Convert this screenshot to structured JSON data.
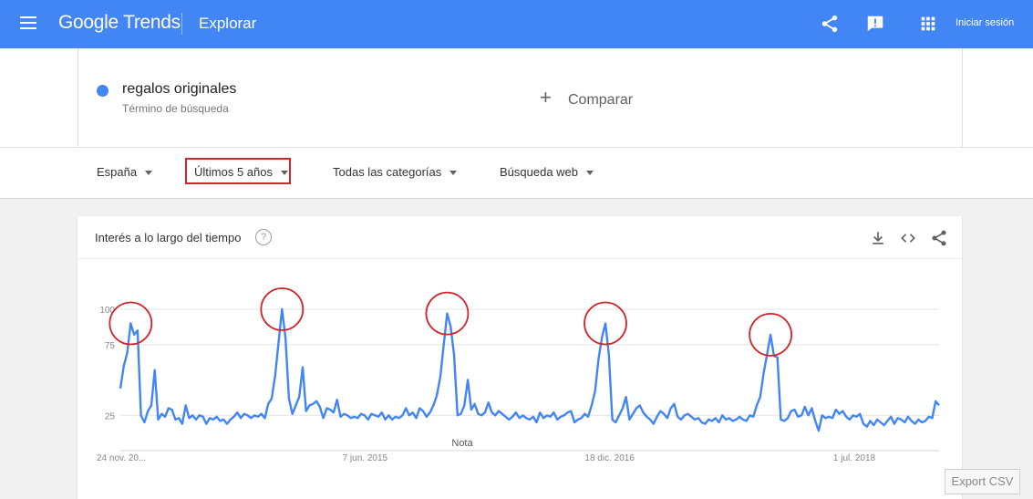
{
  "header": {
    "brand": "Google Trends",
    "section": "Explorar",
    "signin": "Iniciar sesión",
    "icons": [
      "menu-icon",
      "share-icon",
      "feedback-icon",
      "apps-icon"
    ]
  },
  "search": {
    "term": "regalos originales",
    "term_type": "Término de búsqueda",
    "compare_label": "Comparar",
    "term_color": "#4285f4"
  },
  "filters": {
    "region": "España",
    "period": "Últimos 5 años",
    "category": "Todas las categorías",
    "search_type": "Búsqueda web"
  },
  "card": {
    "title": "Interés a lo largo del tiempo",
    "help": "?",
    "note": "Nota",
    "export": "Export CSV",
    "icons": [
      "download-icon",
      "embed-icon",
      "share-icon"
    ]
  },
  "colors": {
    "header": "#4285f4",
    "line": "#4285f4",
    "highlight": "#d0262b"
  },
  "chart_data": {
    "type": "line",
    "x_start": "24 nov. 2013",
    "x_end": "18 nov. 2018",
    "x_ticks": [
      {
        "date": "2013-11-24",
        "label": "24 nov. 20..."
      },
      {
        "date": "2015-06-07",
        "label": "7 jun. 2015"
      },
      {
        "date": "2016-12-18",
        "label": "18 dic. 2016"
      },
      {
        "date": "2018-07-01",
        "label": "1 jul. 2018"
      }
    ],
    "y_ticks": [
      {
        "value": 100,
        "label": "100"
      },
      {
        "value": 75,
        "label": "75"
      },
      {
        "value": 25,
        "label": "25"
      }
    ],
    "ylim": [
      0,
      100
    ],
    "grid": true,
    "series": [
      {
        "name": "regalos originales",
        "values": [
          44,
          60,
          69,
          90,
          82,
          85,
          25,
          20,
          28,
          32,
          57,
          22,
          26,
          24,
          30,
          29,
          22,
          23,
          19,
          32,
          23,
          25,
          22,
          25,
          24,
          19,
          23,
          22,
          24,
          21,
          22,
          19,
          22,
          24,
          27,
          23,
          26,
          25,
          23,
          25,
          24,
          26,
          23,
          33,
          37,
          53,
          77,
          100,
          80,
          37,
          26,
          32,
          38,
          59,
          28,
          32,
          33,
          35,
          31,
          23,
          30,
          29,
          27,
          36,
          24,
          26,
          25,
          23,
          24,
          23,
          26,
          25,
          22,
          26,
          25,
          24,
          27,
          22,
          25,
          22,
          24,
          23,
          25,
          30,
          25,
          27,
          23,
          30,
          28,
          24,
          27,
          32,
          39,
          52,
          75,
          97,
          88,
          68,
          25,
          26,
          32,
          50,
          29,
          33,
          26,
          25,
          27,
          34,
          27,
          25,
          28,
          26,
          24,
          22,
          24,
          27,
          23,
          25,
          23,
          22,
          24,
          20,
          27,
          23,
          25,
          24,
          27,
          22,
          24,
          25,
          27,
          28,
          20,
          22,
          23,
          26,
          24,
          32,
          42,
          65,
          80,
          90,
          68,
          22,
          20,
          25,
          30,
          38,
          22,
          26,
          30,
          32,
          27,
          24,
          22,
          19,
          24,
          28,
          26,
          23,
          30,
          33,
          24,
          22,
          25,
          26,
          24,
          22,
          23,
          20,
          19,
          22,
          21,
          23,
          20,
          25,
          22,
          23,
          21,
          22,
          24,
          22,
          21,
          25,
          24,
          32,
          38,
          55,
          68,
          82,
          67,
          66,
          22,
          21,
          23,
          28,
          29,
          24,
          25,
          31,
          25,
          30,
          21,
          14,
          25,
          23,
          24,
          23,
          29,
          26,
          28,
          24,
          22,
          25,
          24,
          26,
          19,
          17,
          21,
          18,
          22,
          20,
          18,
          21,
          24,
          19,
          23,
          22,
          20,
          24,
          21,
          19,
          22,
          20,
          21,
          24,
          23,
          35,
          32
        ]
      }
    ]
  }
}
